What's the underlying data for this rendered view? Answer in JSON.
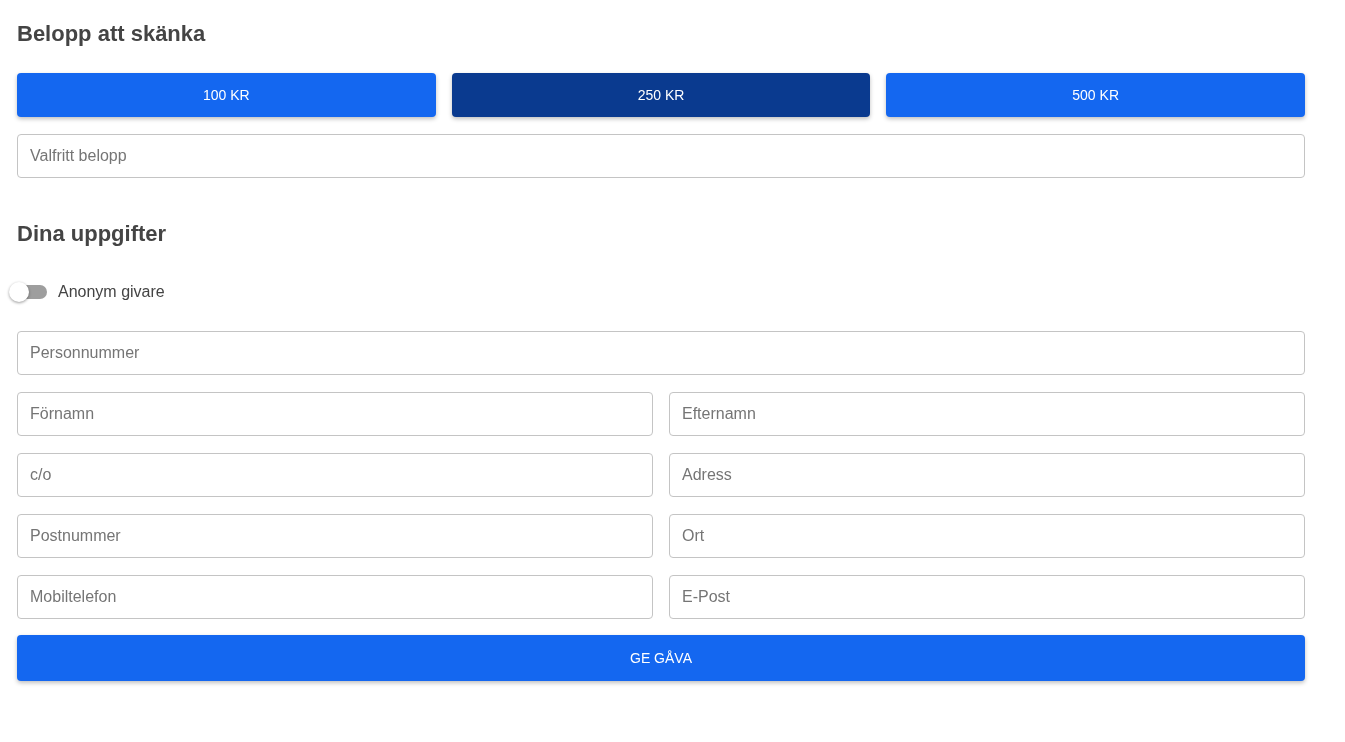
{
  "amount": {
    "title": "Belopp att skänka",
    "options": [
      {
        "label": "100 KR",
        "selected": false
      },
      {
        "label": "250 KR",
        "selected": true
      },
      {
        "label": "500 KR",
        "selected": false
      }
    ],
    "custom": {
      "placeholder": "Valfritt belopp"
    }
  },
  "details": {
    "title": "Dina uppgifter",
    "anonymous": {
      "label": "Anonym givare",
      "on": false
    },
    "fields": [
      {
        "placeholder": "Personnummer",
        "kind": "full"
      },
      {
        "placeholder": "Förnamn",
        "kind": "half"
      },
      {
        "placeholder": "Efternamn",
        "kind": "half"
      },
      {
        "placeholder": "c/o",
        "kind": "half"
      },
      {
        "placeholder": "Adress",
        "kind": "half"
      },
      {
        "placeholder": "Postnummer",
        "kind": "half"
      },
      {
        "placeholder": "Ort",
        "kind": "half"
      },
      {
        "placeholder": "Mobiltelefon",
        "kind": "half"
      },
      {
        "placeholder": "E-Post",
        "kind": "half"
      }
    ],
    "submit": "GE GÅVA"
  }
}
